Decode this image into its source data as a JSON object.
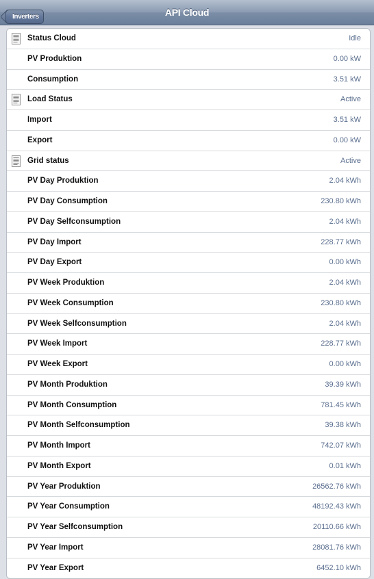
{
  "navbar": {
    "title": "API Cloud",
    "back_label": "Inverters"
  },
  "rows": [
    {
      "label": "Status Cloud",
      "value": "Idle",
      "icon": "document-icon"
    },
    {
      "label": "PV Produktion",
      "value": "0.00 kW"
    },
    {
      "label": "Consumption",
      "value": "3.51 kW"
    },
    {
      "label": "Load Status",
      "value": "Active",
      "icon": "document-icon"
    },
    {
      "label": "Import",
      "value": "3.51 kW"
    },
    {
      "label": "Export",
      "value": "0.00 kW"
    },
    {
      "label": "Grid status",
      "value": "Active",
      "icon": "document-icon"
    },
    {
      "label": "PV Day Produktion",
      "value": "2.04 kWh"
    },
    {
      "label": "PV Day Consumption",
      "value": "230.80 kWh"
    },
    {
      "label": "PV Day Selfconsumption",
      "value": "2.04 kWh"
    },
    {
      "label": "PV Day Import",
      "value": "228.77 kWh"
    },
    {
      "label": "PV Day Export",
      "value": "0.00 kWh"
    },
    {
      "label": "PV Week Produktion",
      "value": "2.04 kWh"
    },
    {
      "label": "PV Week Consumption",
      "value": "230.80 kWh"
    },
    {
      "label": "PV Week Selfconsumption",
      "value": "2.04 kWh"
    },
    {
      "label": "PV Week Import",
      "value": "228.77 kWh"
    },
    {
      "label": "PV Week Export",
      "value": "0.00 kWh"
    },
    {
      "label": "PV Month Produktion",
      "value": "39.39 kWh"
    },
    {
      "label": "PV Month Consumption",
      "value": "781.45 kWh"
    },
    {
      "label": "PV Month Selfconsumption",
      "value": "39.38 kWh"
    },
    {
      "label": "PV Month Import",
      "value": "742.07 kWh"
    },
    {
      "label": "PV Month Export",
      "value": "0.01 kWh"
    },
    {
      "label": "PV Year Produktion",
      "value": "26562.76 kWh"
    },
    {
      "label": "PV Year Consumption",
      "value": "48192.43 kWh"
    },
    {
      "label": "PV Year Selfconsumption",
      "value": "20110.66 kWh"
    },
    {
      "label": "PV Year Import",
      "value": "28081.76 kWh"
    },
    {
      "label": "PV Year Export",
      "value": "6452.10 kWh"
    }
  ]
}
